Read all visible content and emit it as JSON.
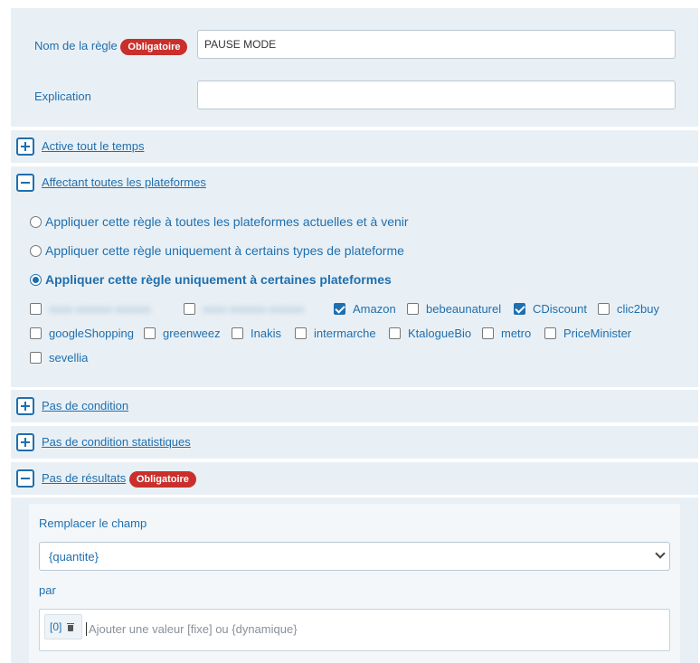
{
  "rule_name": {
    "label": "Nom de la règle",
    "badge": "Obligatoire",
    "value": "PAUSE MODE"
  },
  "explanation": {
    "label": "Explication",
    "value": ""
  },
  "sections": {
    "active": "Active tout le temps",
    "platforms": "Affectant toutes les plateformes",
    "condition": "Pas de condition",
    "stat_condition": "Pas de condition statistiques",
    "results": "Pas de résultats",
    "results_badge": "Obligatoire"
  },
  "platform_options": [
    {
      "label": "Appliquer cette règle à toutes les plateformes actuelles et à venir",
      "selected": false
    },
    {
      "label": "Appliquer cette règle uniquement à certains types de plateforme",
      "selected": false
    },
    {
      "label": "Appliquer cette règle uniquement à certaines plateformes",
      "selected": true
    }
  ],
  "platforms": [
    {
      "label": "xxxx-xxxxxx-xxxxxx",
      "checked": false,
      "blurred": true
    },
    {
      "label": "xxxx-xxxxxx-xxxxxx",
      "checked": false,
      "blurred": true
    },
    {
      "label": "Amazon",
      "checked": true
    },
    {
      "label": "bebeaunaturel",
      "checked": false
    },
    {
      "label": "CDiscount",
      "checked": true
    },
    {
      "label": "clic2buy",
      "checked": false
    },
    {
      "label": "googleShopping",
      "checked": false
    },
    {
      "label": "greenweez",
      "checked": false
    },
    {
      "label": "Inakis",
      "checked": false
    },
    {
      "label": "intermarche",
      "checked": false
    },
    {
      "label": "KtalogueBio",
      "checked": false
    },
    {
      "label": "metro",
      "checked": false
    },
    {
      "label": "PriceMinister",
      "checked": false
    },
    {
      "label": "sevellia",
      "checked": false
    }
  ],
  "results": {
    "replace_label": "Remplacer le champ",
    "field_value": "{quantite}",
    "by_label": "par",
    "tag": "[0]",
    "value_placeholder": "Ajouter une valeur [fixe] ou {dynamique}"
  },
  "colors": {
    "accent": "#1f6fae",
    "badge": "#c9302c",
    "panel": "#e9f0f5"
  }
}
